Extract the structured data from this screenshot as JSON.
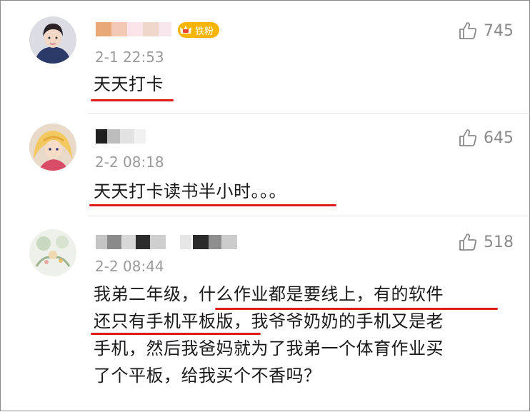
{
  "comments": [
    {
      "badge": "铁粉",
      "time": "2-1 22:53",
      "likes": "745",
      "lines": [
        "天天打卡"
      ]
    },
    {
      "time": "2-2 08:18",
      "likes": "645",
      "lines": [
        "天天打卡读书半小时。。。"
      ]
    },
    {
      "time": "2-2 08:44",
      "likes": "518",
      "lines": [
        "我弟二年级，什么作业都是要线上，有的软件",
        "还只有手机平板版，我爷爷奶奶的手机又是老",
        "手机，然后我爸妈就为了我弟一个体育作业买",
        "了个平板，给我买个不香吗？"
      ]
    }
  ],
  "colors": {
    "underline": "#e01a1a",
    "badge": "#f7b500",
    "meta": "#9a9a9a"
  },
  "icons": [
    "thumbs-up-icon",
    "crown-icon"
  ]
}
